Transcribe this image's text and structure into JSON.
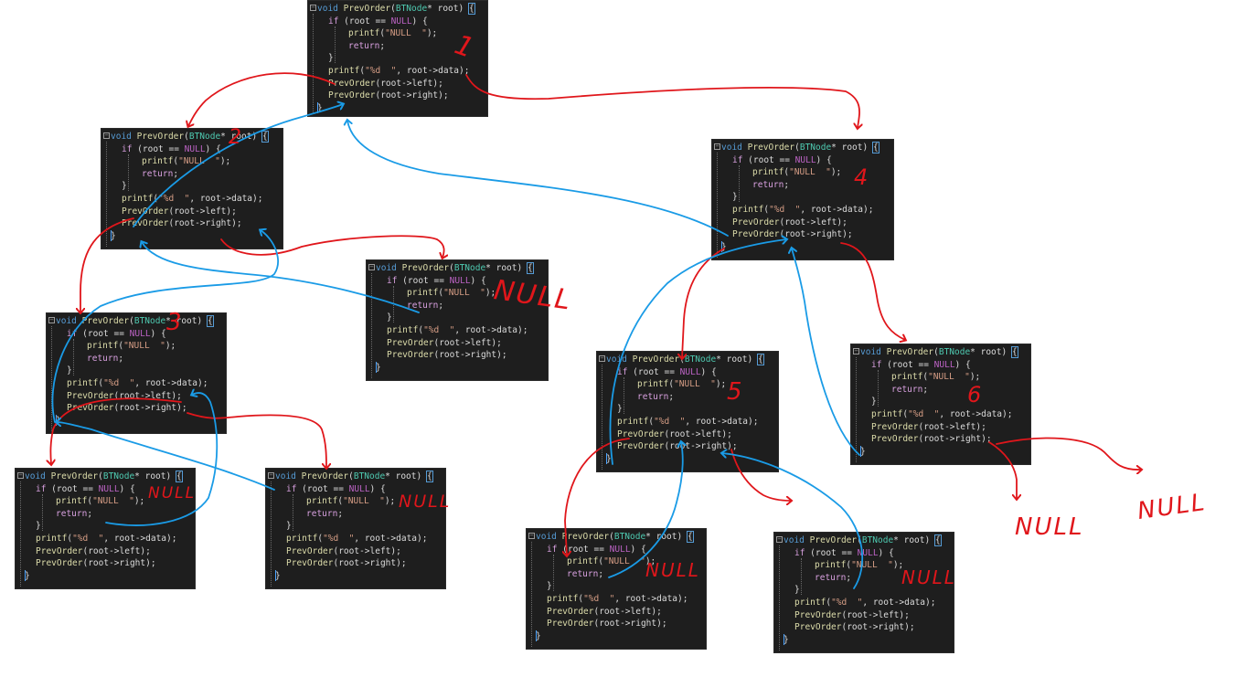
{
  "code": {
    "line1_kw": "void",
    "line1_fn": "PrevOrder",
    "line1_open": "(",
    "line1_type": "BTNode",
    "line1_rest": "* root)",
    "line1_brace": "{",
    "line2_if": "if",
    "line2_rest": " (root == ",
    "line2_null": "NULL",
    "line2_end": ") {",
    "line3_fn": "printf",
    "line3_open": "(",
    "line3_str": "\"NULL  \"",
    "line3_end": ");",
    "line4_kw": "return",
    "line4_end": ";",
    "line5": "}",
    "line6_fn": "printf",
    "line6_open": "(",
    "line6_str": "\"%d  \"",
    "line6_end": ", root->data);",
    "line7_fn": "PrevOrder",
    "line7_end": "(root->left);",
    "line8_fn": "PrevOrder",
    "line8_end": "(root->right);",
    "line9": "}"
  },
  "annotations": {
    "labels": [
      {
        "id": "n1",
        "text": "1"
      },
      {
        "id": "n2",
        "text": "2"
      },
      {
        "id": "n3",
        "text": "3"
      },
      {
        "id": "n4",
        "text": "4"
      },
      {
        "id": "n5",
        "text": "5"
      },
      {
        "id": "n6",
        "text": "6"
      },
      {
        "id": "null_a",
        "text": "NULL"
      },
      {
        "id": "null_b",
        "text": "NULL"
      },
      {
        "id": "null_c",
        "text": "NULL"
      },
      {
        "id": "null_d",
        "text": "NULL"
      },
      {
        "id": "null_e",
        "text": "NULL"
      },
      {
        "id": "null_f",
        "text": "NULL"
      },
      {
        "id": "null_g",
        "text": "NULL"
      }
    ]
  },
  "colors": {
    "code_background": "#1e1e1e",
    "call_arrow": "#e0161b",
    "return_arrow": "#1a9be6",
    "keyword": "#569cd6",
    "function": "#dcdcaa",
    "type": "#4ec9b0",
    "control": "#d8a0df",
    "string": "#d69d85"
  }
}
